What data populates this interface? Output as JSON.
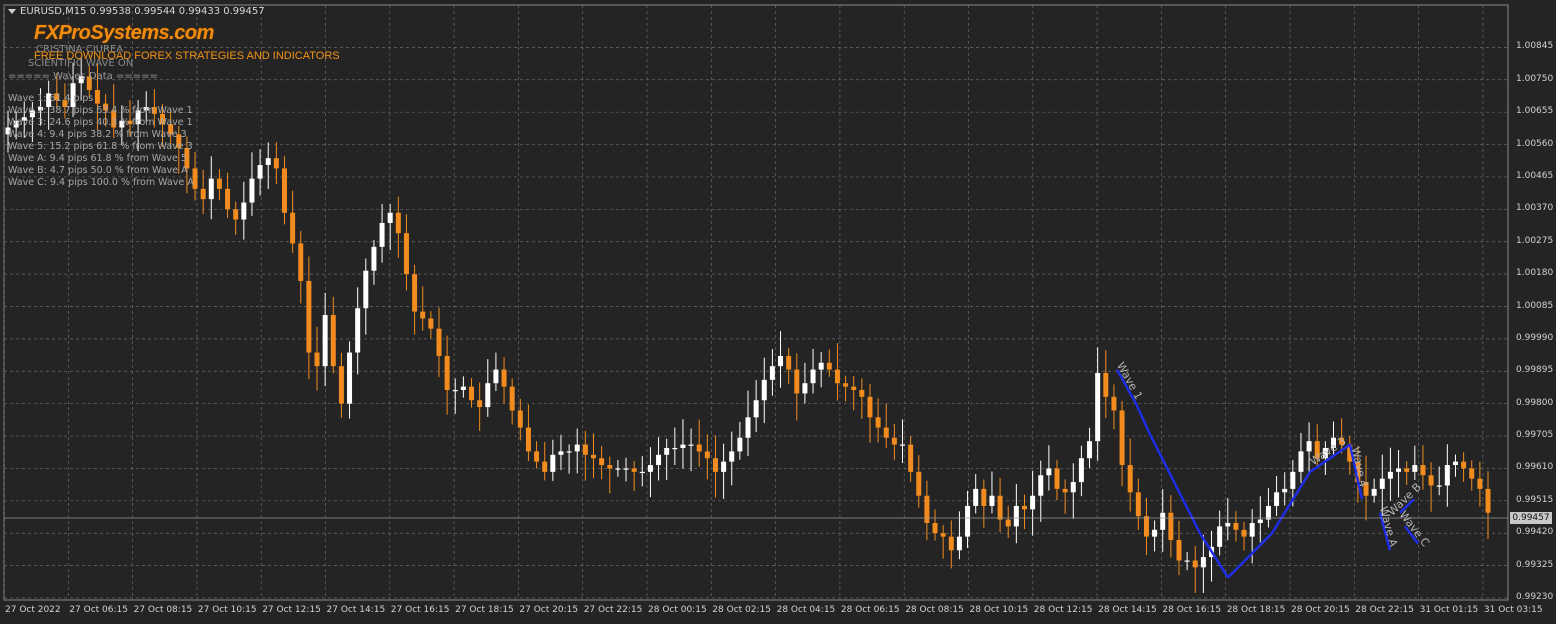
{
  "window": {
    "symbol_line": "EURUSD,M15  0.99538 0.99544 0.99433 0.99457"
  },
  "branding": {
    "logo_text": "FXProSystems.com",
    "tagline": "FREE DOWNLOAD FOREX STRATEGIES AND INDICATORS",
    "author_ghost": "CRISTINA CIUREA",
    "sub_ghost": "SCIENTIFIC WAVE ON"
  },
  "waves_panel": {
    "title": "===== Waves Data =====",
    "lines": [
      "Wave 1: 61.4 pips",
      "Wave 2: 38.7 pips 63.4 % from Wave 1",
      "Wave 3: 24.6 pips 40.3 % from Wave 1",
      "Wave 4: 9.4 pips 38.2 % from Wave 3",
      "Wave 5: 15.2 pips 61.8 % from Wave 3",
      "Wave A: 9.4 pips 61.8 % from Wave 5",
      "Wave B: 4.7 pips 50.0 % from Wave A",
      "Wave C: 9.4 pips 100.0 % from Wave A"
    ]
  },
  "colors": {
    "background": "#242424",
    "grid": "#6a6a6a",
    "bull_candle": "#ffffff",
    "bear_candle": "#f28c1e",
    "wave_line": "#1e2de6",
    "wave_label": "#b4b4b4"
  },
  "chart_data": {
    "type": "candlestick",
    "symbol": "EURUSD",
    "timeframe": "M15",
    "ylim": [
      0.9923,
      1.0094
    ],
    "grid": true,
    "last_price": "0.99457",
    "y_tick_labels": [
      "1.00845",
      "1.00750",
      "1.00655",
      "1.00560",
      "1.00465",
      "1.00370",
      "1.00275",
      "1.00180",
      "1.00085",
      "0.99990",
      "0.99895",
      "0.99800",
      "0.99705",
      "0.99610",
      "0.99515",
      "0.99420",
      "0.99325",
      "0.99230"
    ],
    "x_tick_labels": [
      "27 Oct 2022",
      "27 Oct 06:15",
      "27 Oct 08:15",
      "27 Oct 10:15",
      "27 Oct 12:15",
      "27 Oct 14:15",
      "27 Oct 16:15",
      "27 Oct 18:15",
      "27 Oct 20:15",
      "27 Oct 22:15",
      "28 Oct 00:15",
      "28 Oct 02:15",
      "28 Oct 04:15",
      "28 Oct 06:15",
      "28 Oct 08:15",
      "28 Oct 10:15",
      "28 Oct 12:15",
      "28 Oct 14:15",
      "28 Oct 16:15",
      "28 Oct 18:15",
      "28 Oct 20:15",
      "28 Oct 22:15",
      "31 Oct 01:15",
      "31 Oct 03:15"
    ],
    "close_path": [
      1.0061,
      1.0063,
      1.0064,
      1.0066,
      1.0067,
      1.0071,
      1.0069,
      1.0067,
      1.0074,
      1.0076,
      1.0072,
      1.0068,
      1.0066,
      1.0061,
      1.0063,
      1.0062,
      1.0066,
      1.0067,
      1.0065,
      1.0062,
      1.0059,
      1.0055,
      1.0049,
      1.0043,
      1.004,
      1.0046,
      1.0043,
      1.0037,
      1.0034,
      1.0039,
      1.0046,
      1.005,
      1.0052,
      1.0049,
      1.0036,
      1.0027,
      1.0016,
      0.9995,
      0.9991,
      1.0006,
      0.9991,
      0.998,
      0.9995,
      1.0008,
      1.0019,
      1.0026,
      1.0033,
      1.0036,
      1.003,
      1.0018,
      1.0007,
      1.0005,
      1.0002,
      0.9994,
      0.9984,
      0.9984,
      0.9985,
      0.9981,
      0.9979,
      0.9986,
      0.999,
      0.9985,
      0.9978,
      0.9973,
      0.9966,
      0.9963,
      0.996,
      0.9965,
      0.9966,
      0.9966,
      0.9968,
      0.9965,
      0.9964,
      0.9962,
      0.9961,
      0.9961,
      0.9961,
      0.996,
      0.996,
      0.9962,
      0.9965,
      0.9967,
      0.9967,
      0.9968,
      0.9968,
      0.9966,
      0.9964,
      0.996,
      0.9963,
      0.9966,
      0.997,
      0.9976,
      0.9981,
      0.9987,
      0.9991,
      0.9994,
      0.999,
      0.9983,
      0.9986,
      0.999,
      0.9992,
      0.999,
      0.9986,
      0.9985,
      0.9984,
      0.9982,
      0.9976,
      0.9973,
      0.997,
      0.9968,
      0.9968,
      0.996,
      0.9953,
      0.9945,
      0.9942,
      0.9941,
      0.9937,
      0.9941,
      0.995,
      0.9955,
      0.995,
      0.9953,
      0.9946,
      0.9944,
      0.995,
      0.9949,
      0.9953,
      0.9959,
      0.9961,
      0.9955,
      0.9954,
      0.9957,
      0.9964,
      0.9969,
      0.9989,
      0.9982,
      0.9978,
      0.9962,
      0.9954,
      0.9947,
      0.9941,
      0.9943,
      0.9948,
      0.994,
      0.9934,
      0.9934,
      0.9932,
      0.9935,
      0.9938,
      0.9944,
      0.9945,
      0.9943,
      0.9941,
      0.9945,
      0.9946,
      0.995,
      0.9954,
      0.9955,
      0.996,
      0.9966,
      0.9969,
      0.9964,
      0.9967,
      0.997,
      0.9968,
      0.9963,
      0.9957,
      0.9953,
      0.9955,
      0.9958,
      0.996,
      0.9961,
      0.996,
      0.9962,
      0.9959,
      0.9956,
      0.9956,
      0.9962,
      0.9963,
      0.9961,
      0.9958,
      0.9955,
      0.9948
    ],
    "waves": [
      {
        "label": "Wave 1",
        "from": [
          1117,
          0.999
        ],
        "to": [
          1136,
          0.998
        ]
      },
      {
        "label": "",
        "from": [
          1136,
          0.998
        ],
        "to": [
          1150,
          0.9971
        ]
      },
      {
        "label": "",
        "from": [
          1150,
          0.9971
        ],
        "to": [
          1200,
          0.9942
        ]
      },
      {
        "label": "",
        "from": [
          1200,
          0.9942
        ],
        "to": [
          1228,
          0.9929
        ]
      },
      {
        "label": "",
        "from": [
          1228,
          0.9929
        ],
        "to": [
          1272,
          0.9942
        ]
      },
      {
        "label": "",
        "from": [
          1272,
          0.9942
        ],
        "to": [
          1310,
          0.996
        ]
      },
      {
        "label": "Wave 3",
        "from": [
          1310,
          0.996
        ],
        "to": [
          1350,
          0.9968
        ]
      },
      {
        "label": "Wave 4",
        "from": [
          1350,
          0.9968
        ],
        "to": [
          1362,
          0.9952
        ]
      },
      {
        "label": "Wave A",
        "from": [
          1380,
          0.9948
        ],
        "to": [
          1390,
          0.9937
        ]
      },
      {
        "label": "Wave C",
        "from": [
          1405,
          0.9944
        ],
        "to": [
          1418,
          0.9939
        ]
      },
      {
        "label": "Wave B",
        "from": [
          1400,
          0.9948
        ],
        "to": [
          1414,
          0.9952
        ]
      }
    ]
  }
}
